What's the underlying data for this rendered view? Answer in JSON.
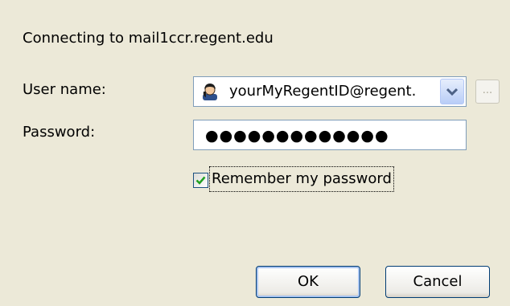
{
  "dialog": {
    "connecting_text": "Connecting to mail1ccr.regent.edu",
    "user_label": "User name:",
    "user_value": "yourMyRegentID@regent.",
    "browse_label": "...",
    "password_label": "Password:",
    "password_masked": "●●●●●●●●●●●●●",
    "remember_label": "Remember my password",
    "remember_checked": true,
    "ok_label": "OK",
    "cancel_label": "Cancel"
  },
  "icons": {
    "user": "user-account-icon",
    "dropdown": "chevron-down-icon",
    "check": "checkmark-icon"
  },
  "colors": {
    "background": "#ece9d8",
    "field_border": "#7f9db9",
    "check_green": "#21a121",
    "dropdown_blue": "#b9cdf7"
  }
}
